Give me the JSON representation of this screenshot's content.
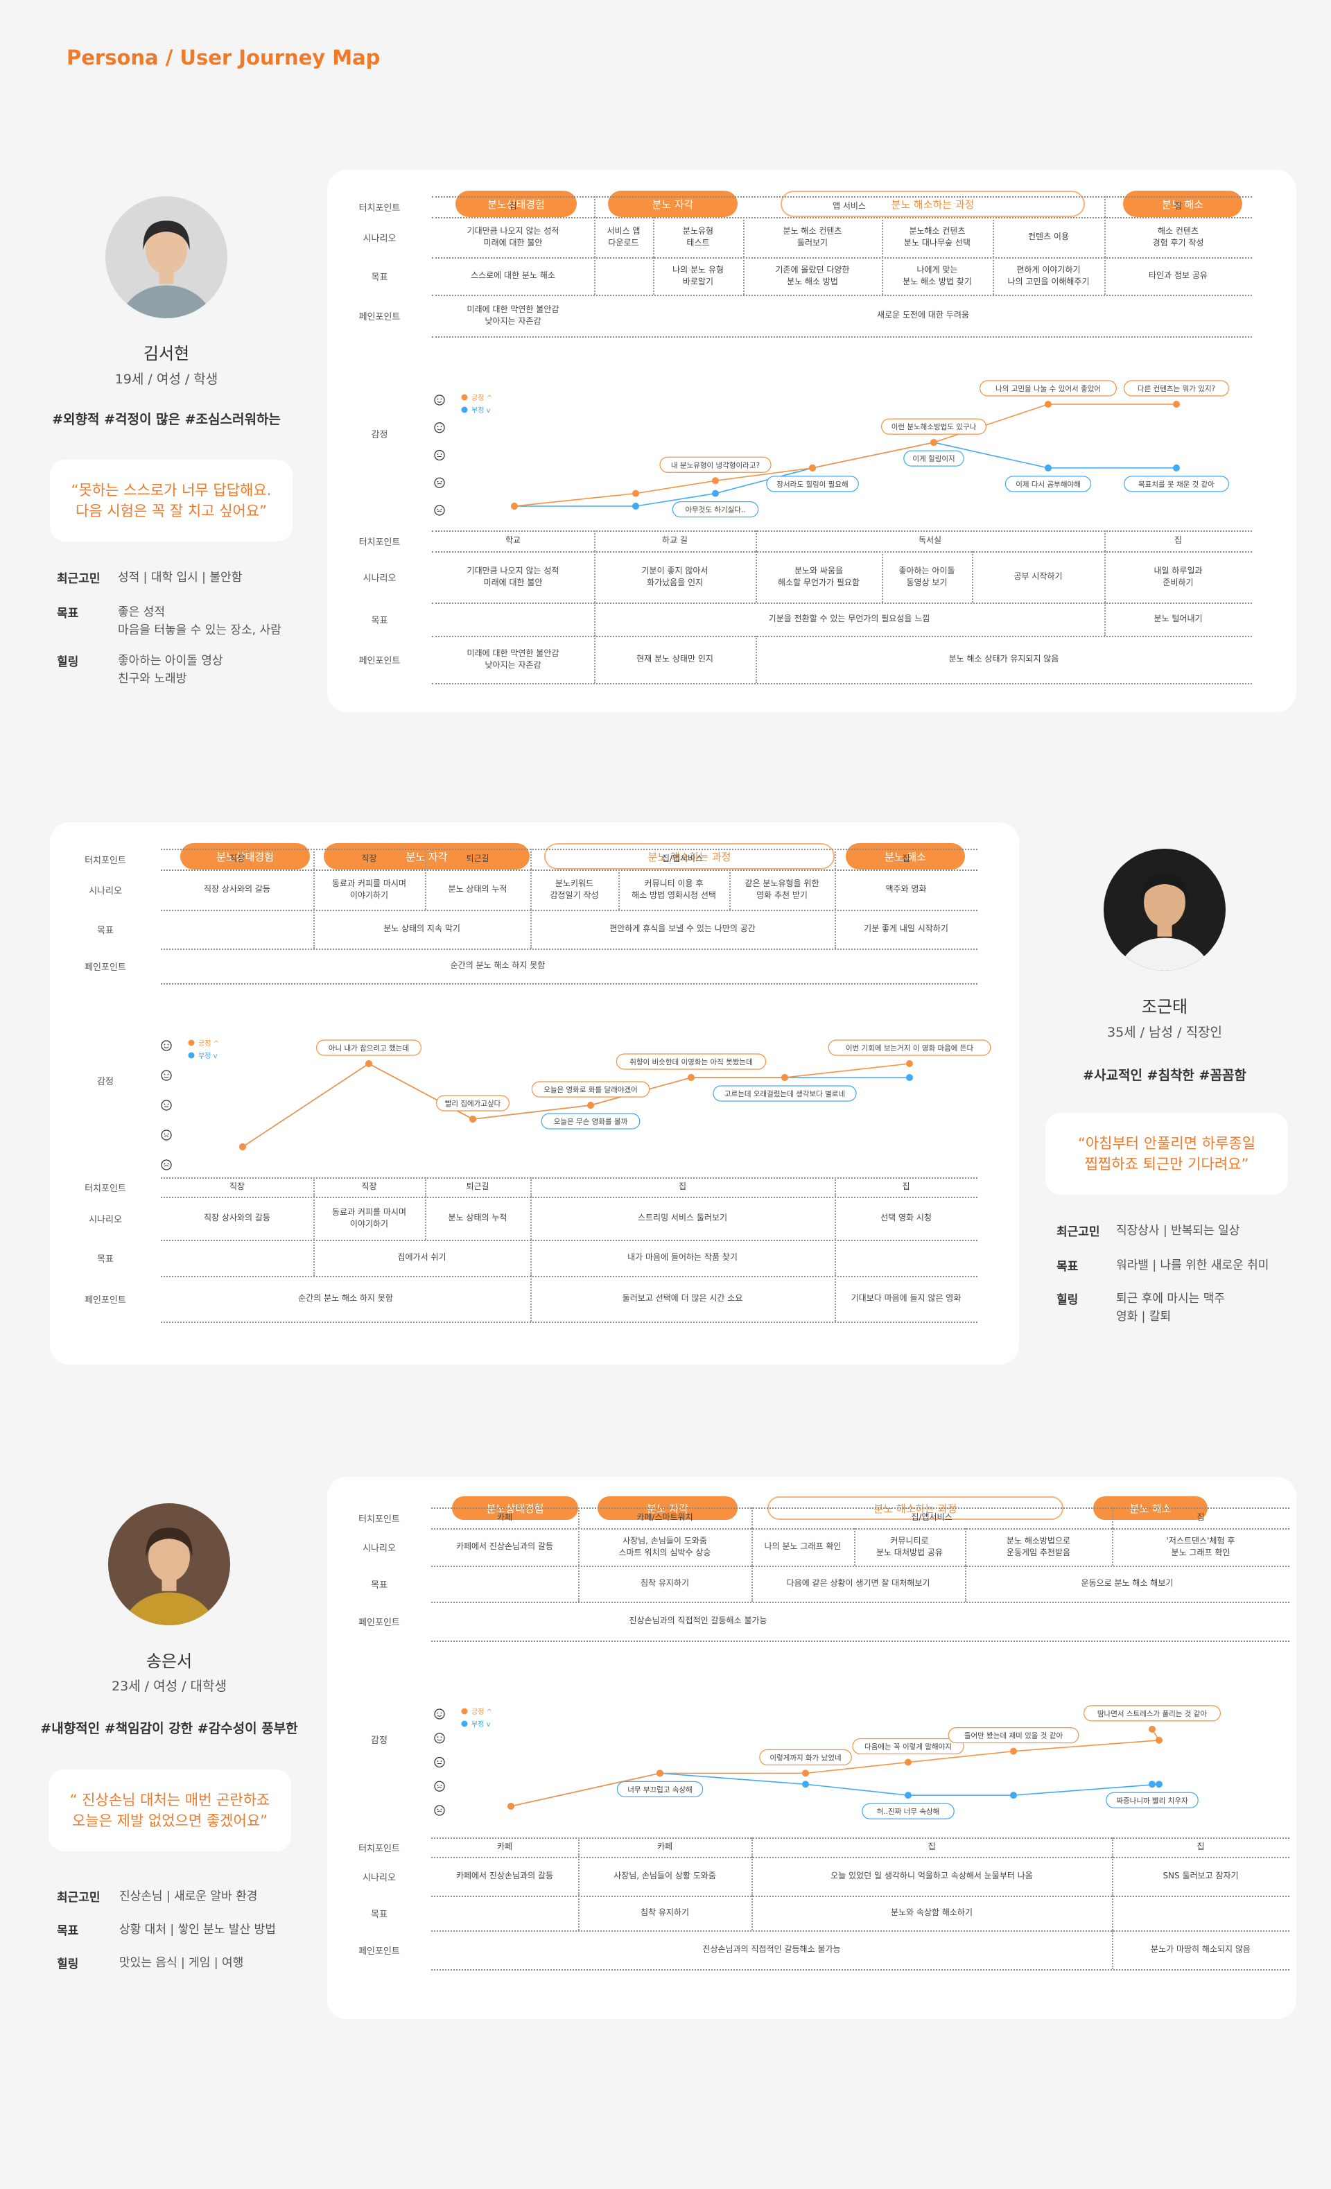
{
  "page_title": "Persona / User Journey Map",
  "row_labels": {
    "touch": "터치포인트",
    "scenario": "시나리오",
    "goal": "목표",
    "pain": "페인포인트",
    "emotion": "감정"
  },
  "legend": {
    "positive": "긍정 ^",
    "negative": "부정 v"
  },
  "colors": {
    "accent": "#f7913f",
    "positive": "#f7913f",
    "negative": "#3fa9f5"
  },
  "personas": [
    {
      "name": "김서현",
      "meta": "19세 / 여성 / 학생",
      "tags": "#외향적  #걱정이 많은  #조심스러워하는",
      "quote": "“못하는 스스로가 너무 답답해요.\n다음 시험은 꼭 잘 치고 싶어요”",
      "info": [
        {
          "label": "최근고민",
          "value": "성적 | 대학 입시 | 불안함"
        },
        {
          "label": "목표",
          "value": "좋은 성적\n마음을 터놓을 수 있는 장소, 사람"
        },
        {
          "label": "힐링",
          "value": "좋아하는 아이돌 영상\n친구와 노래방"
        }
      ],
      "phases": [
        {
          "label": "분노상태경험"
        },
        {
          "label": "분노 자각"
        },
        {
          "label": "분노 해소하는 과정"
        },
        {
          "label": "분노 해소"
        }
      ],
      "top": {
        "touch": [
          {
            "t": "집"
          },
          {
            "t": "앱 서비스"
          },
          {
            "t": "집"
          }
        ],
        "scenario": [
          {
            "t": "기대만큼 나오지 않는 성적\n미래에 대한 불안"
          },
          {
            "t": "서비스 앱\n다운로드"
          },
          {
            "t": "분노유형\n테스트"
          },
          {
            "t": "분노 해소 컨텐츠\n둘러보기"
          },
          {
            "t": "분노해소 컨텐츠\n분노 대나무숲 선택"
          },
          {
            "t": "컨텐츠 이용"
          },
          {
            "t": "해소 컨텐츠\n경험 후기 작성"
          }
        ],
        "goal": [
          {
            "t": "스스로에 대한 분노 해소"
          },
          {
            "t": ""
          },
          {
            "t": "나의 분노 유형\n바로알기"
          },
          {
            "t": "기존에 몰랐던 다양한\n분노 해소 방법"
          },
          {
            "t": "나에게 맞는\n분노 해소 방법 찾기"
          },
          {
            "t": "편하게 이야기하기\n나의 고민을 이해해주기"
          },
          {
            "t": "타인과 정보 공유"
          }
        ],
        "pain": [
          {
            "t": "미래에 대한 막연한 불안감\n낮아지는 자존감"
          },
          {
            "t": "새로운 도전에 대한 두려움"
          }
        ]
      },
      "emotion": {
        "positive": [
          2,
          3,
          4,
          5,
          7,
          10,
          10
        ],
        "negative": [
          2,
          2,
          3,
          5,
          7,
          5,
          5
        ],
        "pos_labels": [
          {
            "t": "내 분노유형이 냉각형이라고?"
          },
          {
            "t": "이런 분노해소방법도 있구나"
          },
          {
            "t": "나의 고민을 나눌 수 있어서 좋았어"
          },
          {
            "t": "다른 컨텐츠는 뭐가 있지?"
          }
        ],
        "neg_labels": [
          {
            "t": "아무것도 하기싫다.."
          },
          {
            "t": "장서라도 힐링이 필요해"
          },
          {
            "t": "이게 힐링이지"
          },
          {
            "t": "이제 다시 공부해야해"
          },
          {
            "t": "목표치를 못 채운 것 같아"
          }
        ]
      },
      "bottom": {
        "touch": [
          {
            "t": "학교"
          },
          {
            "t": "하교 길"
          },
          {
            "t": "독서실"
          },
          {
            "t": "집"
          }
        ],
        "scenario": [
          {
            "t": "기대만큼 나오지 않는 성적\n미래에 대한 불안"
          },
          {
            "t": "기분이 좋지 않아서\n화가났음을 인지"
          },
          {
            "t": "분노와 싸움을\n해소할 무언가가 필요함"
          },
          {
            "t": "좋아하는 아이돌\n동영상 보기"
          },
          {
            "t": "공부 시작하기"
          },
          {
            "t": "내일 하루일과\n준비하기"
          }
        ],
        "goal": [
          {
            "t": ""
          },
          {
            "t": "기분을 전환할 수 있는 무언가의 필요성을 느낌"
          },
          {
            "t": "분노 털어내기"
          }
        ],
        "pain": [
          {
            "t": "미래에 대한 막연한 불안감\n낮아지는 자존감"
          },
          {
            "t": "현재 분노 상태만 인지"
          },
          {
            "t": "분노 해소 상태가 유지되지 않음"
          }
        ]
      }
    },
    {
      "name": "조근태",
      "meta": "35세 / 남성 / 직장인",
      "tags": "#사교적인  #침착한  #꼼꼼함",
      "quote": "“아침부터 안풀리면 하루종일\n찝찝하죠 퇴근만 기다려요”",
      "info": [
        {
          "label": "최근고민",
          "value": "직장상사 | 반복되는 일상"
        },
        {
          "label": "목표",
          "value": "워라밸 | 나를 위한 새로운 취미"
        },
        {
          "label": "힐링",
          "value": "퇴근 후에 마시는 맥주\n영화 | 칼퇴"
        }
      ],
      "phases": [
        {
          "label": "분노상태경험"
        },
        {
          "label": "분노 자각"
        },
        {
          "label": "분노 해소하는 과정"
        },
        {
          "label": "분노 해소"
        }
      ],
      "top": {
        "touch": [
          {
            "t": "직장"
          },
          {
            "t": "직장"
          },
          {
            "t": "퇴근길"
          },
          {
            "t": "집/앱서비스"
          },
          {
            "t": "집"
          }
        ],
        "scenario": [
          {
            "t": "직장 상사와의 갈등"
          },
          {
            "t": "동료과 커피를 마시며\n이야기하기"
          },
          {
            "t": "분노 상태의 누적"
          },
          {
            "t": "분노키워드\n감정일기 작성"
          },
          {
            "t": "커뮤니티 이용 후\n해소 방법 영화시청 선택"
          },
          {
            "t": "같은 분노유형을 위한\n영화 추천 받기"
          },
          {
            "t": "맥주와 영화"
          }
        ],
        "goal": [
          {
            "t": ""
          },
          {
            "t": "분노 상태의 지속 막기"
          },
          {
            "t": "편안하게 휴식을 보낼 수 있는 나만의 공간"
          },
          {
            "t": "기분 좋게 내일 시작하기"
          }
        ],
        "pain": [
          {
            "t": "순간의 분노 해소 하지 못함"
          }
        ]
      },
      "emotion": {
        "positive": [
          3,
          9,
          5,
          6,
          8,
          8,
          9
        ],
        "negative": [
          3,
          9,
          5,
          6,
          8,
          8,
          8
        ],
        "pos_labels": [
          {
            "t": "아니 내가 참으려고 했는데"
          },
          {
            "t": "빨리 집에가고싶다"
          },
          {
            "t": "오늘은 영화로 화를 달래야겠어"
          },
          {
            "t": "취향이 비슷한데 이영화는 아직 못봤는데"
          },
          {
            "t": "이번 기회에 보는거지 이 영화 마음에 든다"
          }
        ],
        "neg_labels": [
          {
            "t": "오늘은 무슨 영화를 볼까"
          },
          {
            "t": "고르는데 오래걸렸는데 생각보다 별로네"
          }
        ]
      },
      "bottom": {
        "touch": [
          {
            "t": "직장"
          },
          {
            "t": "직장"
          },
          {
            "t": "퇴근길"
          },
          {
            "t": "집"
          },
          {
            "t": "집"
          }
        ],
        "scenario": [
          {
            "t": "직장 상사와의 갈등"
          },
          {
            "t": "동료과 커피를 마시며\n이야기하기"
          },
          {
            "t": "분노 상태의 누적"
          },
          {
            "t": "스트리밍 서비스 둘러보기"
          },
          {
            "t": "선택 영화 시청"
          }
        ],
        "goal": [
          {
            "t": ""
          },
          {
            "t": "집에가서 쉬기"
          },
          {
            "t": "내가 마음에 들어하는 작품 찾기"
          },
          {
            "t": ""
          }
        ],
        "pain": [
          {
            "t": "순간의 분노 해소 하지 못함"
          },
          {
            "t": "둘러보고 선택에 더 많은 시간 소요"
          },
          {
            "t": "기대보다 마음에 들지 않은 영화"
          }
        ]
      }
    },
    {
      "name": "송은서",
      "meta": "23세 / 여성 / 대학생",
      "tags": "#내향적인  #책임감이 강한  #감수성이 풍부한",
      "quote": "“ 진상손님 대처는 매번 곤란하죠\n오늘은 제발 없었으면 좋겠어요”",
      "info": [
        {
          "label": "최근고민",
          "value": "진상손님 | 새로운 알바 환경"
        },
        {
          "label": "목표",
          "value": "상황 대처 | 쌓인 분노 발산 방법"
        },
        {
          "label": "힐링",
          "value": "맛있는 음식 | 게임 | 여행"
        }
      ],
      "phases": [
        {
          "label": "분노상태경험"
        },
        {
          "label": "분노 자각"
        },
        {
          "label": "분노 해소하는 과정"
        },
        {
          "label": "분노 해소"
        }
      ],
      "top": {
        "touch": [
          {
            "t": "카페"
          },
          {
            "t": "카페/스마트워치"
          },
          {
            "t": "집/앱서비스"
          },
          {
            "t": "집"
          }
        ],
        "scenario": [
          {
            "t": "카페에서 진상손님과의 갈등"
          },
          {
            "t": "사장님, 손님들이 도와줌\n스마트 워치의 심박수 상승"
          },
          {
            "t": "나의 분노 그래프 확인"
          },
          {
            "t": "커뮤니티로\n분노 대처방법 공유"
          },
          {
            "t": "분노 해소방법으로\n운동게임 추천받음"
          },
          {
            "t": "'저스트댄스'체험 후\n분노 그래프 확인"
          }
        ],
        "goal": [
          {
            "t": ""
          },
          {
            "t": "침착 유지하기"
          },
          {
            "t": "다음에 같은 상황이 생기면 잘 대처해보기"
          },
          {
            "t": "운동으로 분노 해소 해보기"
          }
        ],
        "pain": [
          {
            "t": "진상손님과의 직접적인 갈등해소 불가능"
          }
        ]
      },
      "emotion": {
        "positive": [
          2,
          5,
          5,
          6,
          7,
          8,
          9
        ],
        "negative": [
          2,
          5,
          4,
          3,
          3,
          4,
          4
        ],
        "pos_labels": [
          {
            "t": "이렇게까지 화가 났었네"
          },
          {
            "t": "다음에는 꼭 이렇게 말해야지"
          },
          {
            "t": "들어만 봤는데 재미 있을 것 같아"
          },
          {
            "t": "땀나면서 스트레스가 풀리는 것 같아"
          }
        ],
        "neg_labels": [
          {
            "t": "너무 부끄럽고 속상해"
          },
          {
            "t": "허..진짜 너무 속상해"
          },
          {
            "t": "짜증나니까 빨리 치우자"
          }
        ]
      },
      "bottom": {
        "touch": [
          {
            "t": "카페"
          },
          {
            "t": "카페"
          },
          {
            "t": "집"
          },
          {
            "t": "집"
          }
        ],
        "scenario": [
          {
            "t": "카페에서 진상손님과의 갈등"
          },
          {
            "t": "사장님, 손님들이 상황 도와줌"
          },
          {
            "t": "오늘 있었던 일 생각하니 억울하고 속상해서 눈물부터 나옴"
          },
          {
            "t": "SNS 둘러보고 잠자기"
          }
        ],
        "goal": [
          {
            "t": ""
          },
          {
            "t": "침착 유지하기"
          },
          {
            "t": "분노와 속상함 해소하기"
          },
          {
            "t": ""
          }
        ],
        "pain": [
          {
            "t": "진상손님과의 직접적인 갈등해소 불가능"
          },
          {
            "t": "분노가 마땅히 해소되지 않음"
          }
        ]
      }
    }
  ]
}
